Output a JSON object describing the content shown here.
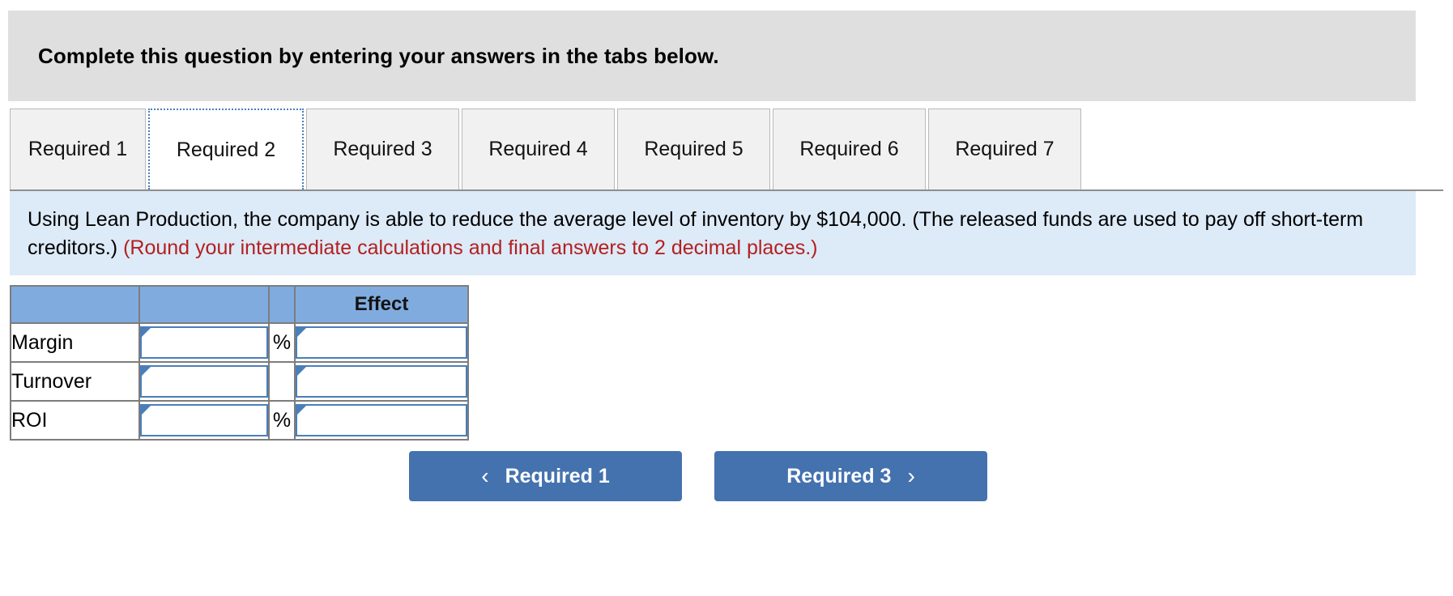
{
  "banner": {
    "text": "Complete this question by entering your answers in the tabs below."
  },
  "tabs": {
    "items": [
      {
        "label": "Required 1",
        "active": false
      },
      {
        "label": "Required 2",
        "active": true
      },
      {
        "label": "Required 3",
        "active": false
      },
      {
        "label": "Required 4",
        "active": false
      },
      {
        "label": "Required 5",
        "active": false
      },
      {
        "label": "Required 6",
        "active": false
      },
      {
        "label": "Required 7",
        "active": false
      }
    ]
  },
  "instructions": {
    "main_text": "Using Lean Production, the company is able to reduce the average level of inventory by $104,000. (The released funds are used to pay off short-term creditors.) ",
    "rounding_note": "(Round your intermediate calculations and final answers to 2 decimal places.)"
  },
  "table": {
    "headers": [
      "",
      "",
      "",
      "Effect"
    ],
    "rows": [
      {
        "label": "Margin",
        "value": "",
        "unit": "%",
        "effect": ""
      },
      {
        "label": "Turnover",
        "value": "",
        "unit": "",
        "effect": ""
      },
      {
        "label": "ROI",
        "value": "",
        "unit": "%",
        "effect": ""
      }
    ]
  },
  "navigation": {
    "prev_label": "Required 1",
    "prev_icon": "chevron-left-icon",
    "prev_chevron": "‹",
    "next_label": "Required 3",
    "next_icon": "chevron-right-icon",
    "next_chevron": "›"
  },
  "colors": {
    "banner_bg": "#dfdfdf",
    "instruction_bg": "#ddeaf7",
    "note_red": "#b32020",
    "table_header_blue": "#80abdf",
    "input_border_blue": "#4a7ebb",
    "button_blue": "#4472ae",
    "tab_inactive_bg": "#f1f1f1"
  }
}
